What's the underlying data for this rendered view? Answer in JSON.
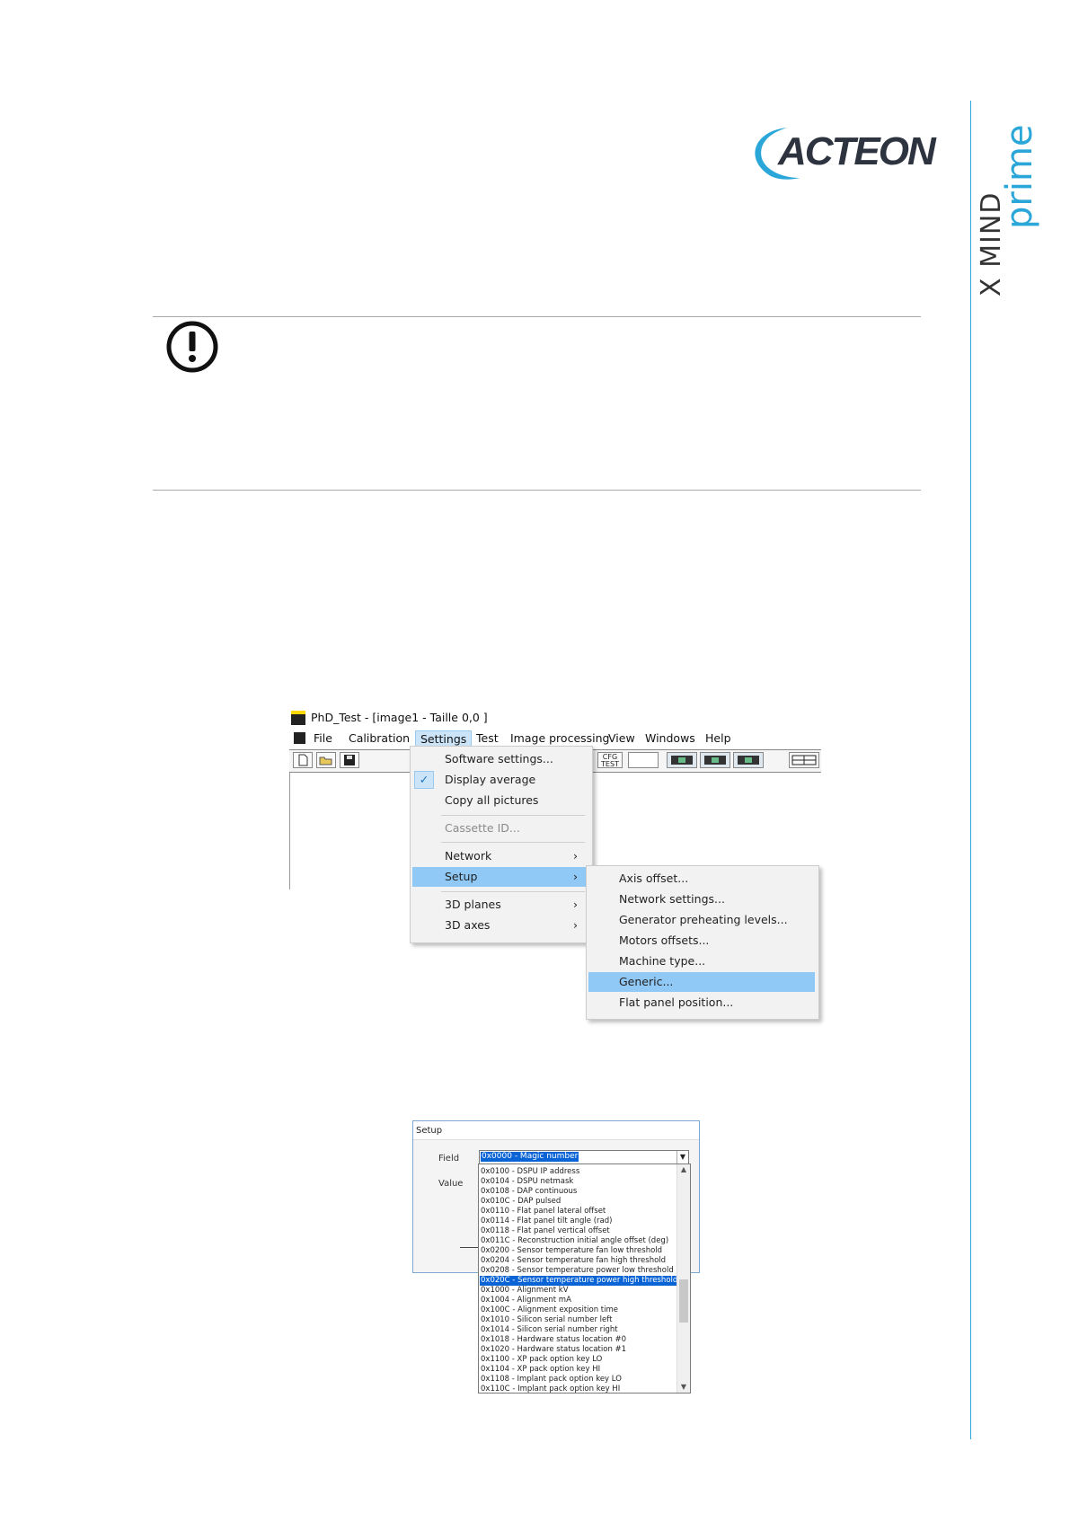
{
  "brand": {
    "company_logo": "ACTEON",
    "product_prefix": "X MIND",
    "product_suffix": "prime",
    "accent_color": "#2aa7d8"
  },
  "notice": {
    "icon": "warning-exclamation-icon"
  },
  "app_window": {
    "title": "PhD_Test - [image1 - Taille 0,0 ]",
    "menu": [
      "File",
      "Calibration",
      "Settings",
      "Test",
      "Image processing",
      "View",
      "Windows",
      "Help"
    ],
    "toolbar_cfg_label": "CFG TEST"
  },
  "settings_menu": {
    "items": [
      {
        "label": "Software settings..."
      },
      {
        "label": "Display average",
        "checked": true
      },
      {
        "label": "Copy all pictures"
      },
      {
        "label": "Cassette ID...",
        "disabled": true
      },
      {
        "label": "Network",
        "submenu": true
      },
      {
        "label": "Setup",
        "submenu": true,
        "highlighted": true
      },
      {
        "label": "3D planes",
        "submenu": true
      },
      {
        "label": "3D axes",
        "submenu": true
      }
    ]
  },
  "setup_submenu": {
    "items": [
      {
        "label": "Axis offset..."
      },
      {
        "label": "Network settings..."
      },
      {
        "label": "Generator preheating levels..."
      },
      {
        "label": "Motors offsets..."
      },
      {
        "label": "Machine type..."
      },
      {
        "label": "Generic...",
        "highlighted": true
      },
      {
        "label": "Flat panel position..."
      }
    ]
  },
  "setup_dialog": {
    "title": "Setup",
    "field_label": "Field",
    "value_label": "Value",
    "field_selected": "0x0000 - Magic number",
    "options": [
      "0x0100 - DSPU IP address",
      "0x0104 - DSPU netmask",
      "0x0108 - DAP continuous",
      "0x010C - DAP pulsed",
      "0x0110 - Flat panel lateral offset",
      "0x0114 - Flat panel tilt angle (rad)",
      "0x0118 - Flat panel vertical offset",
      "0x011C - Reconstruction initial angle offset (deg)",
      "0x0200 - Sensor temperature fan low threshold",
      "0x0204 - Sensor temperature fan high threshold",
      "0x0208 - Sensor temperature power low threshold",
      "0x020C - Sensor temperature power high threshold",
      "0x1000 - Alignment kV",
      "0x1004 - Alignment mA",
      "0x100C - Alignment exposition time",
      "0x1010 - Silicon serial number left",
      "0x1014 - Silicon serial number right",
      "0x1018 - Hardware status location #0",
      "0x1020 - Hardware status location #1",
      "0x1100 - XP pack option key LO",
      "0x1104 - XP pack option key HI",
      "0x1108 - Implant pack option key LO",
      "0x110C - Implant pack option key HI"
    ],
    "selected_option_index": 11
  }
}
